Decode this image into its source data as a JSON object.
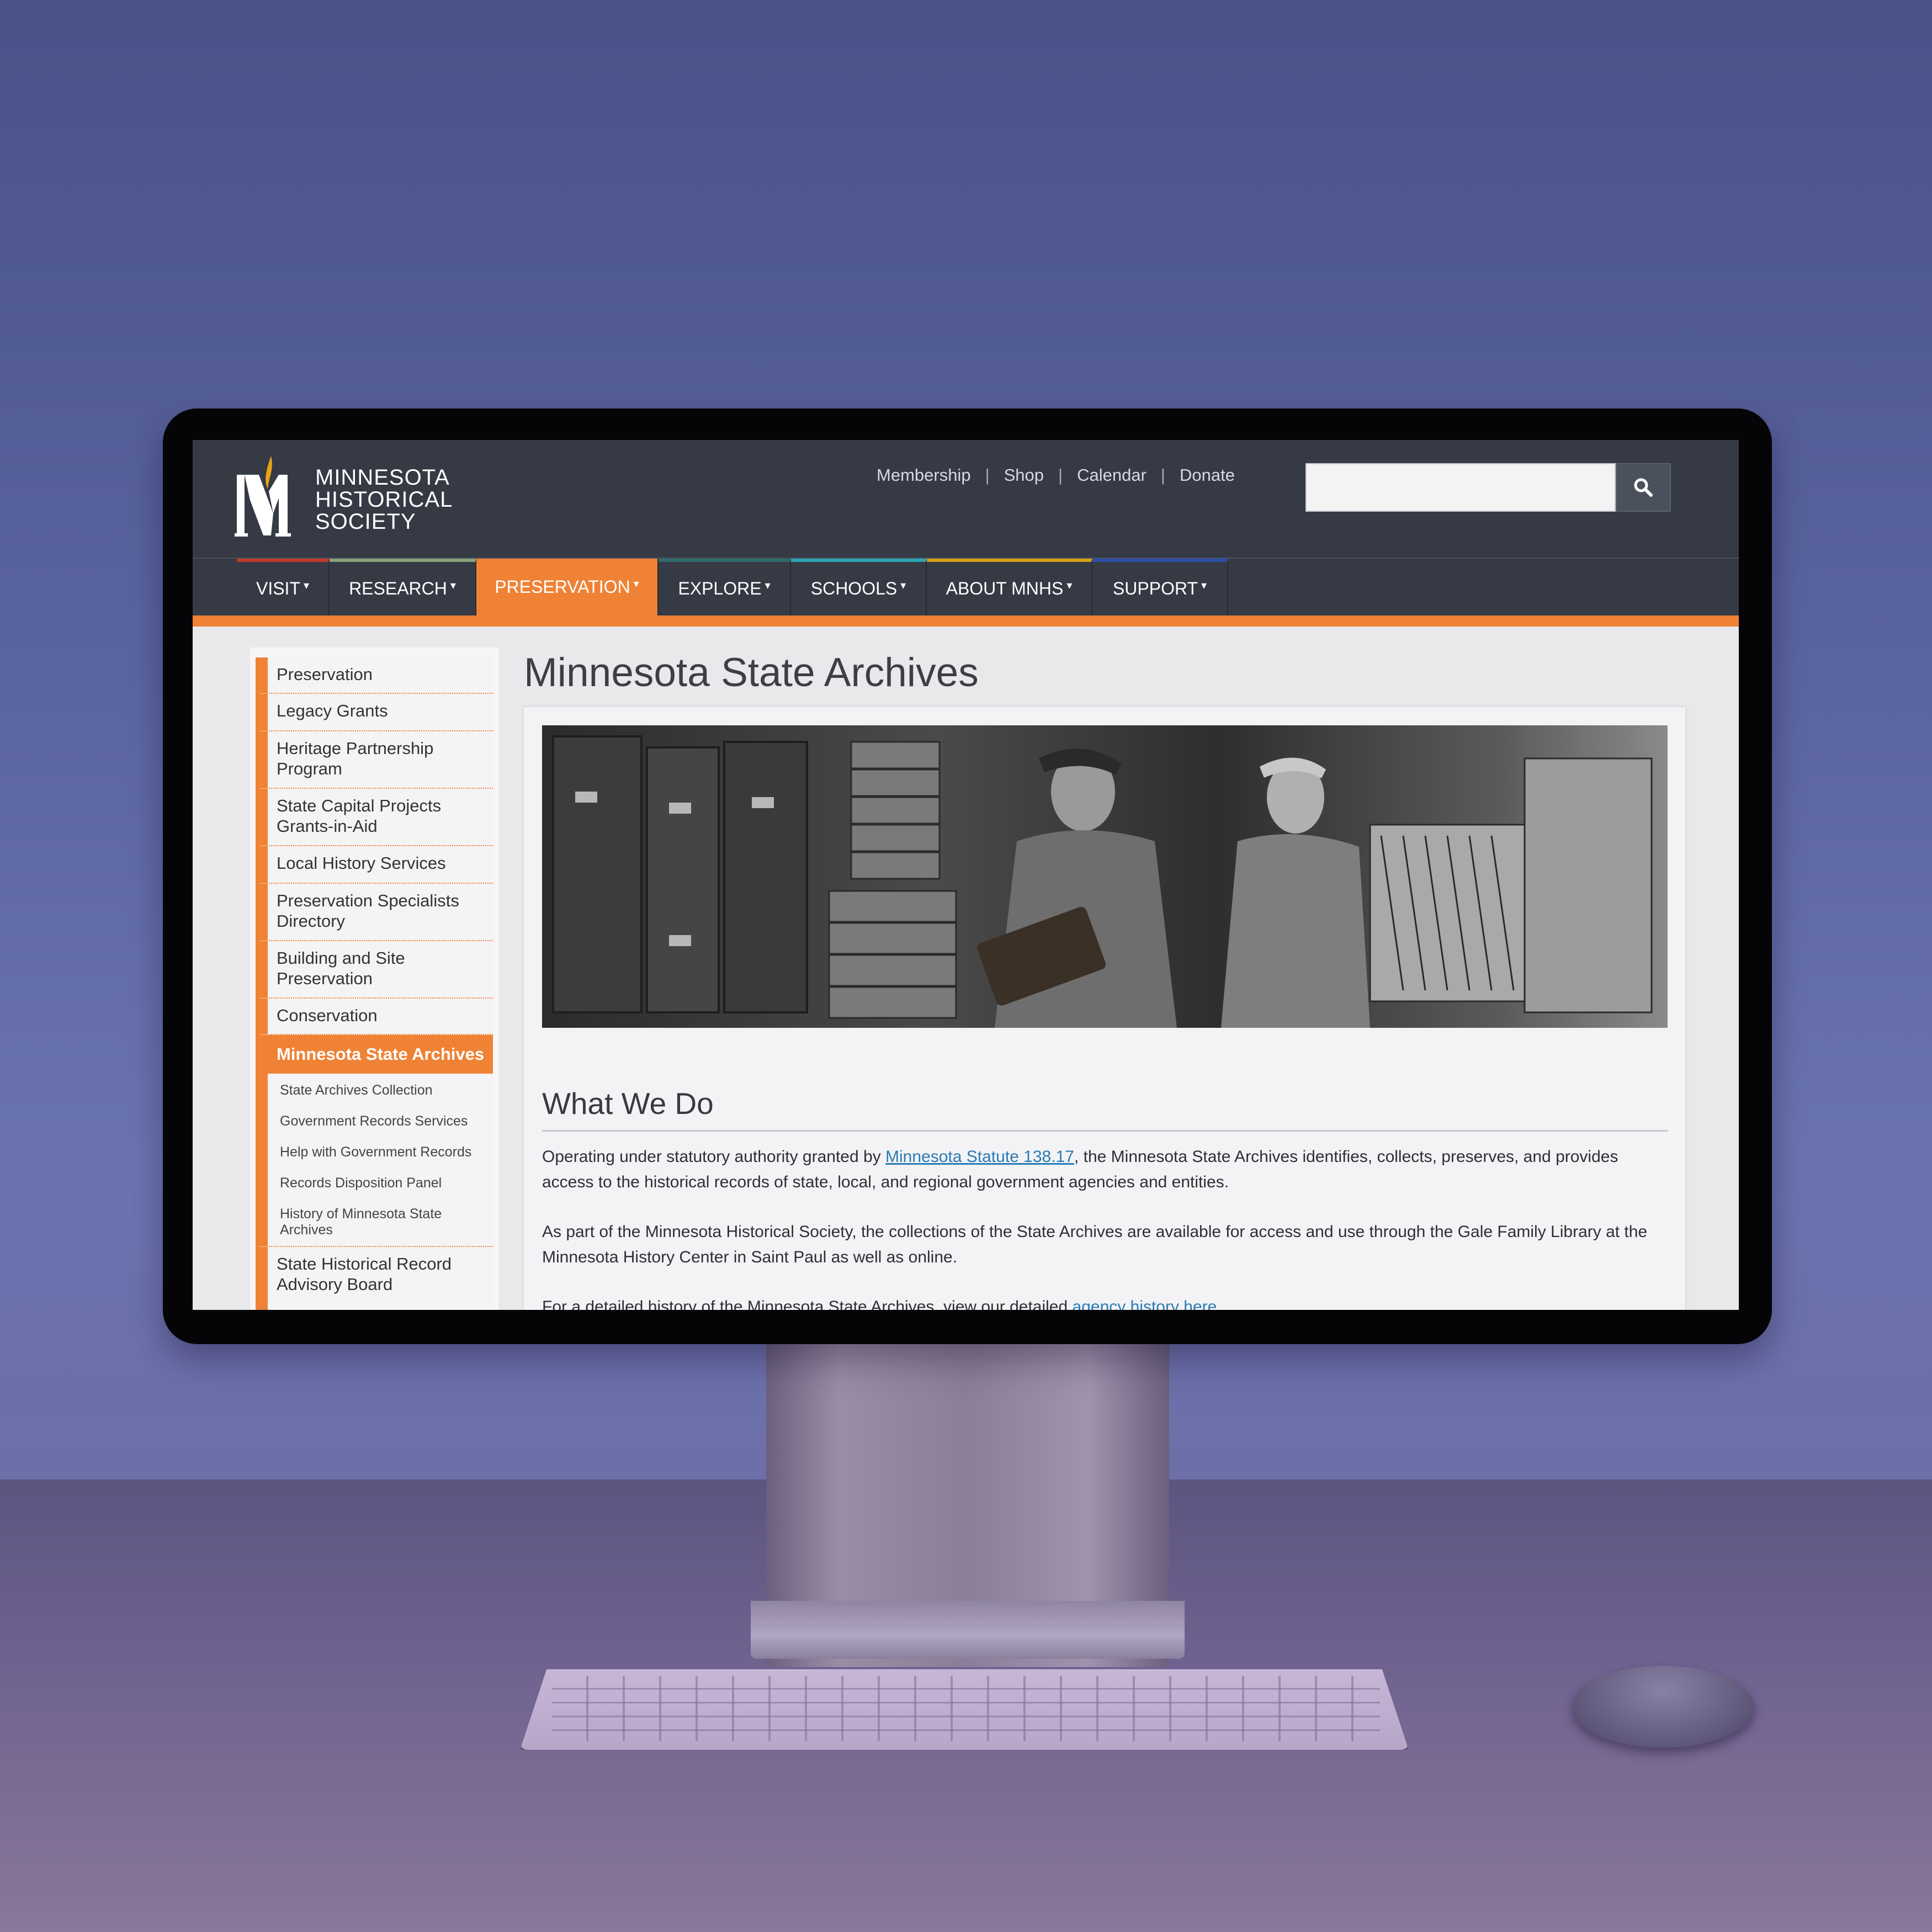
{
  "site": {
    "logo_lines": [
      "MINNESOTA",
      "HISTORICAL",
      "SOCIETY"
    ],
    "utility_links": [
      "Membership",
      "Shop",
      "Calendar",
      "Donate"
    ],
    "utility_separator": "|",
    "search": {
      "placeholder": "",
      "icon": "search-icon"
    }
  },
  "main_nav": {
    "items": [
      {
        "label": "VISIT",
        "accent": "#c0392b"
      },
      {
        "label": "RESEARCH",
        "accent": "#8aa37b"
      },
      {
        "label": "PRESERVATION",
        "accent": "#ef8235",
        "active": true
      },
      {
        "label": "EXPLORE",
        "accent": "#2f6a6a"
      },
      {
        "label": "SCHOOLS",
        "accent": "#2aa6b5"
      },
      {
        "label": "ABOUT MNHS",
        "accent": "#d4a017"
      },
      {
        "label": "SUPPORT",
        "accent": "#2c4fa8"
      }
    ],
    "caret": "▾"
  },
  "sidebar": {
    "items": [
      "Preservation",
      "Legacy Grants",
      "Heritage Partnership Program",
      "State Capital Projects Grants-in-Aid",
      "Local History Services",
      "Preservation Specialists Directory",
      "Building and Site Preservation",
      "Conservation",
      "Minnesota State Archives"
    ],
    "active": "Minnesota State Archives",
    "sub_items": [
      "State Archives Collection",
      "Government Records Services",
      "Help with Government Records",
      "Records Disposition Panel",
      "History of Minnesota State Archives"
    ],
    "after_items": [
      "State Historical Record Advisory Board"
    ]
  },
  "main": {
    "page_title": "Minnesota State Archives",
    "section_title": "What We Do",
    "para1_before": "Operating under statutory authority granted by ",
    "para1_link": "Minnesota Statute 138.17",
    "para1_after": ", the Minnesota State Archives identifies, collects, preserves, and provides access to the historical records of state, local, and regional government agencies and entities.",
    "para2": "As part of the Minnesota Historical Society, the collections of the State Archives are available for access and use through the Gale Family Library at the Minnesota History Center in Saint Paul as well as online.",
    "para3_before": "For a detailed history of the Minnesota State Archives, view our detailed ",
    "para3_link": "agency history here."
  },
  "colors": {
    "accent_orange": "#ef8235",
    "header_bg": "#353a45",
    "link_blue": "#2a7bb5"
  }
}
